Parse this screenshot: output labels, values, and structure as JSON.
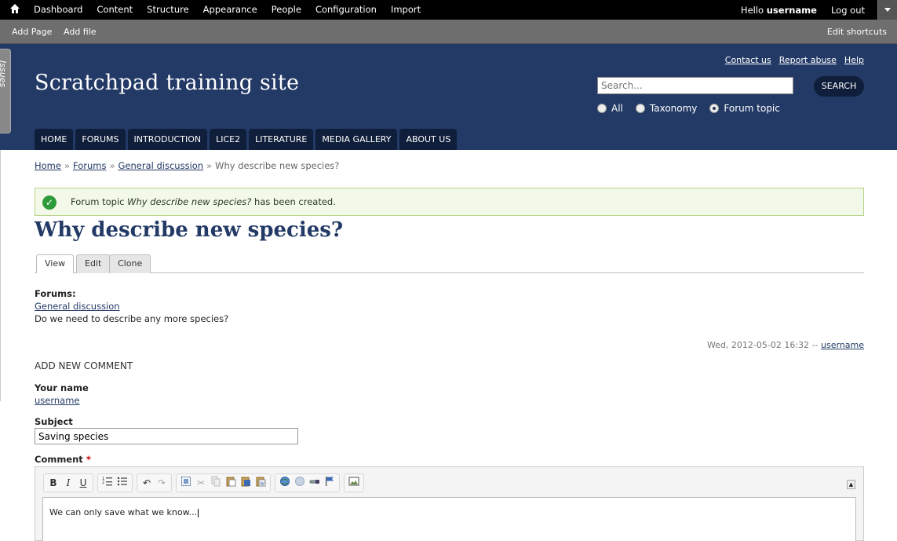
{
  "admin_bar": {
    "menu": [
      "Dashboard",
      "Content",
      "Structure",
      "Appearance",
      "People",
      "Configuration",
      "Import"
    ],
    "hello_prefix": "Hello ",
    "username": "username",
    "logout": "Log out"
  },
  "shortcuts": {
    "add_page": "Add Page",
    "add_file": "Add file",
    "edit": "Edit shortcuts"
  },
  "header": {
    "issues_tab": "Issues",
    "site_name": "Scratchpad training site",
    "links": [
      "Contact us",
      "Report abuse",
      "Help"
    ],
    "search_placeholder": "Search...",
    "search_button": "SEARCH",
    "radios": [
      "All",
      "Taxonomy",
      "Forum topic"
    ],
    "radio_selected": "Forum topic",
    "nav": [
      "HOME",
      "FORUMS",
      "INTRODUCTION",
      "LICE2",
      "LITERATURE",
      "MEDIA GALLERY",
      "ABOUT US"
    ]
  },
  "breadcrumb": {
    "items": [
      "Home",
      "Forums",
      "General discussion"
    ],
    "separator": "»",
    "current": "Why describe new species?"
  },
  "status": {
    "prefix": "Forum topic ",
    "title": "Why describe new species?",
    "suffix": " has been created."
  },
  "page": {
    "title": "Why describe new species?",
    "tabs": [
      "View",
      "Edit",
      "Clone"
    ],
    "forums_label": "Forums:",
    "forum_link": "General discussion",
    "body": "Do we need to describe any more species?",
    "submitted_date": "Wed, 2012-05-02 16:32 --",
    "submitted_user": "username"
  },
  "comment_form": {
    "heading": "ADD NEW COMMENT",
    "name_label": "Your name",
    "name_value": "username",
    "subject_label": "Subject",
    "subject_value": "Saving species",
    "comment_label": "Comment",
    "required_mark": "*",
    "comment_value": "We can only save what we know..."
  },
  "editor_toolbar": {
    "groups": [
      [
        "B",
        "I",
        "U"
      ],
      [
        "ordered-list-icon",
        "bullet-list-icon"
      ],
      [
        "undo-icon",
        "redo-icon"
      ],
      [
        "select-all-icon",
        "cut-icon",
        "copy-icon",
        "paste-icon",
        "paste-text-icon",
        "paste-word-icon"
      ],
      [
        "link-icon",
        "unlink-icon",
        "anchor-icon",
        "flag-icon"
      ],
      [
        "image-icon"
      ]
    ]
  }
}
